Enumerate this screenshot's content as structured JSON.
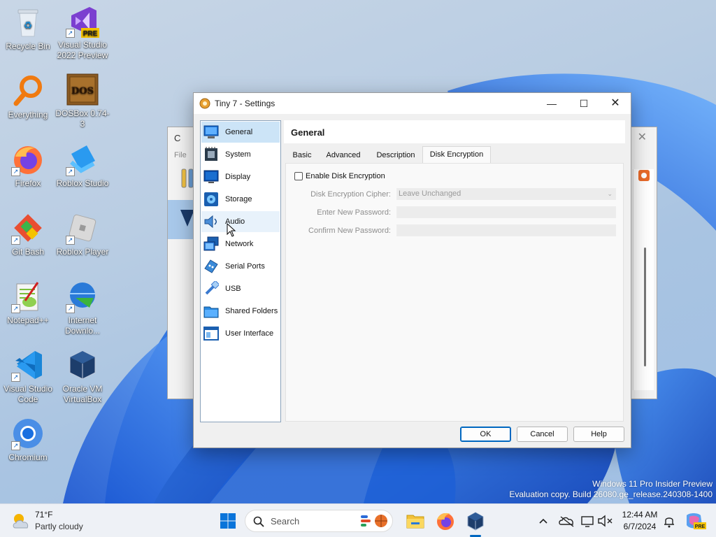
{
  "desktop": {
    "icons": [
      {
        "label": "Recycle Bin"
      },
      {
        "label": "Visual Studio 2022 Preview",
        "badge": "PRE"
      },
      {
        "label": "Everything"
      },
      {
        "label": "DOSBox 0.74-3",
        "glyph": "DOS"
      },
      {
        "label": "Firefox"
      },
      {
        "label": "Roblox Studio"
      },
      {
        "label": "Git Bash"
      },
      {
        "label": "Roblox Player"
      },
      {
        "label": "Notepad++"
      },
      {
        "label": "Internet Downlo..."
      },
      {
        "label": "Visual Studio Code"
      },
      {
        "label": "Oracle VM VirtualBox"
      },
      {
        "label": "Chromium"
      }
    ]
  },
  "background_window": {
    "title": "C",
    "menu_file": "File",
    "close": "✕"
  },
  "dialog": {
    "title": "Tiny 7 - Settings",
    "controls": {
      "minimize": "—",
      "maximize": "☐",
      "close": "✕"
    },
    "nav": [
      {
        "label": "General",
        "icon": "general-icon",
        "selected": true
      },
      {
        "label": "System",
        "icon": "system-icon"
      },
      {
        "label": "Display",
        "icon": "display-icon"
      },
      {
        "label": "Storage",
        "icon": "storage-icon"
      },
      {
        "label": "Audio",
        "icon": "audio-icon",
        "hover": true
      },
      {
        "label": "Network",
        "icon": "network-icon"
      },
      {
        "label": "Serial Ports",
        "icon": "serial-ports-icon"
      },
      {
        "label": "USB",
        "icon": "usb-icon"
      },
      {
        "label": "Shared Folders",
        "icon": "shared-folders-icon"
      },
      {
        "label": "User Interface",
        "icon": "user-interface-icon"
      }
    ],
    "page_title": "General",
    "tabs": [
      {
        "label": "Basic"
      },
      {
        "label": "Advanced"
      },
      {
        "label": "Description"
      },
      {
        "label": "Disk Encryption",
        "active": true
      }
    ],
    "encryption": {
      "enable_label": "Enable Disk Encryption",
      "enabled": false,
      "cipher_label": "Disk Encryption Cipher:",
      "cipher_value": "Leave Unchanged",
      "new_password_label": "Enter New Password:",
      "new_password_value": "",
      "confirm_password_label": "Confirm New Password:",
      "confirm_password_value": ""
    },
    "buttons": {
      "ok": "OK",
      "cancel": "Cancel",
      "help": "Help"
    }
  },
  "watermark": {
    "line1": "Windows 11 Pro Insider Preview",
    "line2": "Evaluation copy. Build 26080.ge_release.240308-1400"
  },
  "taskbar": {
    "weather_temp": "71°F",
    "weather_desc": "Partly cloudy",
    "search_label": "Search",
    "clock_time": "12:44 AM",
    "clock_date": "6/7/2024",
    "copilot_badge": "PRE"
  },
  "colors": {
    "accent": "#0067c0",
    "nav_selected": "#cce4f7",
    "wallpaper_blue": "#1e62d8"
  }
}
